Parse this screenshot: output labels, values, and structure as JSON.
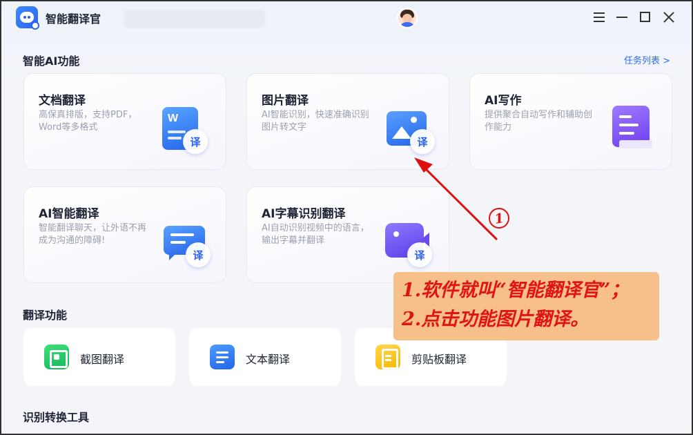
{
  "titlebar": {
    "app_name": "智能翻译官",
    "controls": [
      "menu-icon",
      "minimize-icon",
      "maximize-icon",
      "close-icon"
    ]
  },
  "ai_section": {
    "title": "智能AI功能",
    "task_link": "任务列表 >",
    "cards": [
      {
        "title": "文档翻译",
        "desc": "高保真排版，支持PDF，Word等多格式",
        "icon": "word-doc-icon",
        "badge": "译"
      },
      {
        "title": "图片翻译",
        "desc": "AI智能识别，快速准确识别图片转文字",
        "icon": "image-icon",
        "badge": "译"
      },
      {
        "title": "AI写作",
        "desc": "提供聚合自动写作和辅助创作能力",
        "icon": "writing-icon"
      },
      {
        "title": "AI智能翻译",
        "desc": "智能翻译聊天，让外语不再成为沟通的障碍!",
        "icon": "chat-icon",
        "badge": "译"
      },
      {
        "title": "AI字幕识别翻译",
        "desc": "AI自动识别视频中的语言，输出字幕并翻译",
        "icon": "video-icon",
        "badge": "译"
      }
    ]
  },
  "translate_section": {
    "title": "翻译功能",
    "items": [
      {
        "label": "截图翻译",
        "icon": "screenshot-icon"
      },
      {
        "label": "文本翻译",
        "icon": "text-doc-icon"
      },
      {
        "label": "剪贴板翻译",
        "icon": "clipboard-icon"
      }
    ]
  },
  "convert_section": {
    "title": "识别转换工具"
  },
  "annotation": {
    "marker": "1",
    "lines": [
      "1.软件就叫“智能翻译官”；",
      "2.点击功能图片翻译。"
    ],
    "color": "#e01010",
    "box_color": "#f7bf8a"
  }
}
